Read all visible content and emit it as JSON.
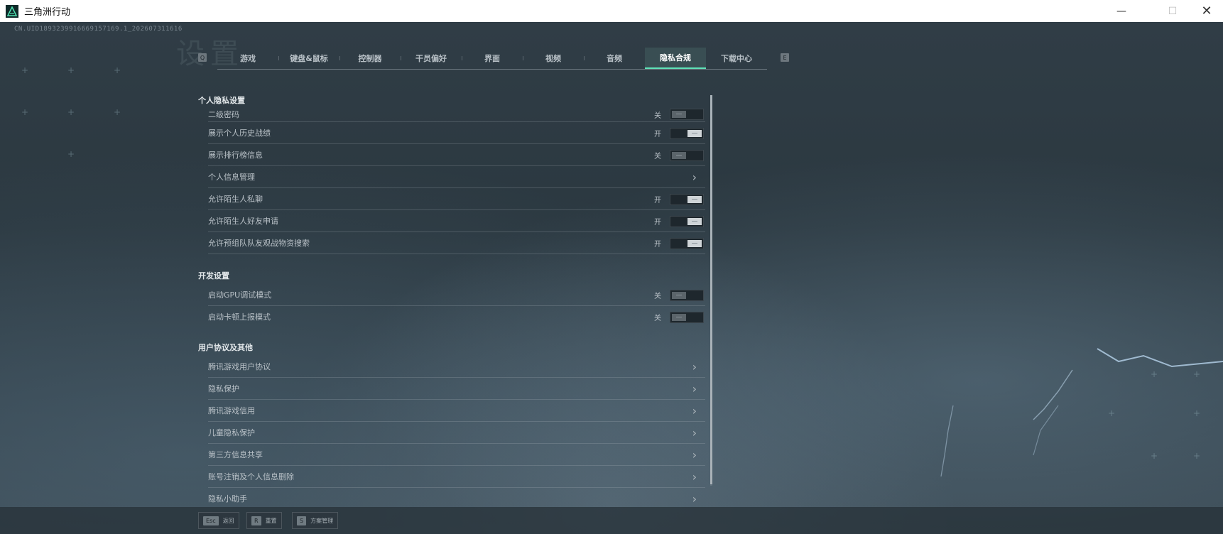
{
  "window": {
    "title": "三角洲行动",
    "min_label": "—",
    "max_label": "☐",
    "close_label": "✕"
  },
  "uid": "CN.UID1893239916669157169.1_202607311616",
  "header": {
    "big_title": "设置"
  },
  "tabs": {
    "prev_key": "Q",
    "next_key": "E",
    "items": [
      {
        "label": "游戏"
      },
      {
        "label": "键盘&鼠标"
      },
      {
        "label": "控制器"
      },
      {
        "label": "干员偏好"
      },
      {
        "label": "界面"
      },
      {
        "label": "视频"
      },
      {
        "label": "音频"
      },
      {
        "label": "隐私合规",
        "active": true
      },
      {
        "label": "下载中心"
      }
    ]
  },
  "sections": [
    {
      "title": "个人隐私设置",
      "rows": [
        {
          "label": "二级密码",
          "type": "toggle",
          "state": "关",
          "on": false
        },
        {
          "label": "展示个人历史战绩",
          "type": "toggle",
          "state": "开",
          "on": true
        },
        {
          "label": "展示排行榜信息",
          "type": "toggle",
          "state": "关",
          "on": false
        },
        {
          "label": "个人信息管理",
          "type": "link"
        },
        {
          "label": "允许陌生人私聊",
          "type": "toggle",
          "state": "开",
          "on": true
        },
        {
          "label": "允许陌生人好友申请",
          "type": "toggle",
          "state": "开",
          "on": true
        },
        {
          "label": "允许预组队队友观战物资搜索",
          "type": "toggle",
          "state": "开",
          "on": true
        }
      ]
    },
    {
      "title": "开发设置",
      "rows": [
        {
          "label": "启动GPU调试模式",
          "type": "toggle",
          "state": "关",
          "on": false
        },
        {
          "label": "启动卡顿上报模式",
          "type": "toggle",
          "state": "关",
          "on": false
        }
      ]
    },
    {
      "title": "用户协议及其他",
      "rows": [
        {
          "label": "腾讯游戏用户协议",
          "type": "link"
        },
        {
          "label": "隐私保护",
          "type": "link"
        },
        {
          "label": "腾讯游戏信用",
          "type": "link"
        },
        {
          "label": "儿童隐私保护",
          "type": "link"
        },
        {
          "label": "第三方信息共享",
          "type": "link"
        },
        {
          "label": "账号注销及个人信息删除",
          "type": "link"
        },
        {
          "label": "隐私小助手",
          "type": "link"
        }
      ]
    }
  ],
  "footer": {
    "buttons": [
      {
        "key": "Esc",
        "label": "返回"
      },
      {
        "key": "R",
        "label": "重置"
      },
      {
        "key": "S",
        "label": "方案管理"
      }
    ]
  },
  "colors": {
    "accent": "#5fe3b8",
    "background": "#2d3a43",
    "toggle_on": "#cfd4d7",
    "toggle_off": "#5b646a"
  }
}
